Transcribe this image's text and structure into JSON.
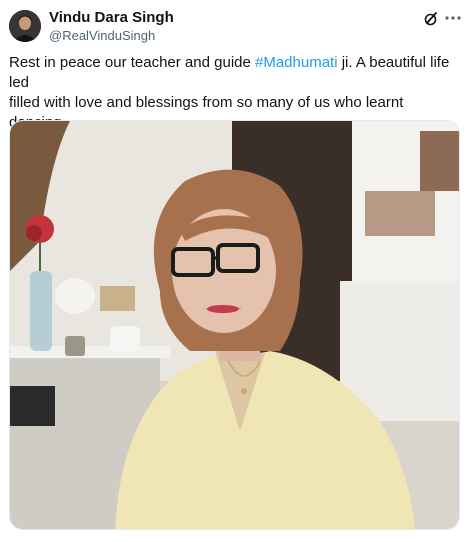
{
  "author": {
    "name": "Vindu Dara Singh",
    "handle": "@RealVinduSingh"
  },
  "icons": {
    "avatar": "avatar",
    "grok": "grok-icon",
    "more": "more-icon",
    "emoji": "folded-hands-icon"
  },
  "tweet": {
    "text_before": "Rest in peace our teacher and guide ",
    "hashtag": "#Madhumati",
    "text_after": " ji. A beautiful life led\nfilled with love and blessings from so many of us who learnt dancing\nfrom this legend"
  },
  "colors": {
    "link": "#1d9bf0",
    "secondary_text": "#536471",
    "primary_text": "#0f1419"
  }
}
